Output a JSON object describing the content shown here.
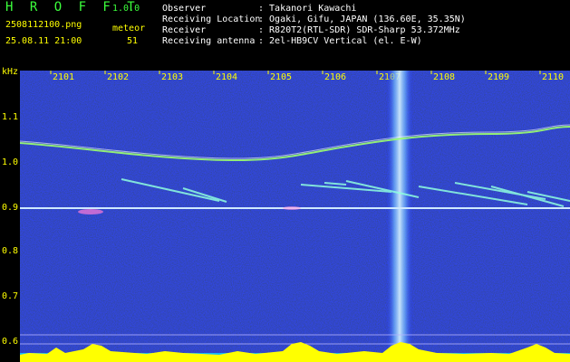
{
  "header": {
    "app_name": "H R O F F T",
    "version": "1.0.0",
    "filename": "2508112100.png",
    "datetime": "25.08.11 21:00",
    "meteor_label": "meteor",
    "meteor_count": "51",
    "observer": {
      "label": "Observer",
      "value": ": Takanori Kawachi"
    },
    "location": {
      "label": "Receiving Location",
      "value": ": Ogaki, Gifu, JAPAN (136.60E, 35.35N)"
    },
    "receiver": {
      "label": "Receiver",
      "value": ": R820T2(RTL-SDR) SDR-Sharp 53.372MHz"
    },
    "antenna": {
      "label": "Receiving antenna",
      "value": ": 2el-HB9CV Vertical (el. E-W)"
    }
  },
  "axes": {
    "y_unit": "kHz",
    "y_ticks": [
      "1.1",
      "1.0",
      "0.9",
      "0.8",
      "0.7",
      "0.6"
    ],
    "x_ticks": [
      "2101",
      "2102",
      "2103",
      "2104",
      "2105",
      "2106",
      "2107",
      "2108",
      "2109",
      "2110"
    ]
  },
  "colors": {
    "background": "#000000",
    "spectrum_bg": "#00008a",
    "label_yellow": "#ffff00",
    "logo_green": "#3cff3c",
    "strong_signal": "#ffffff",
    "carrier_line": "#9adfff"
  }
}
